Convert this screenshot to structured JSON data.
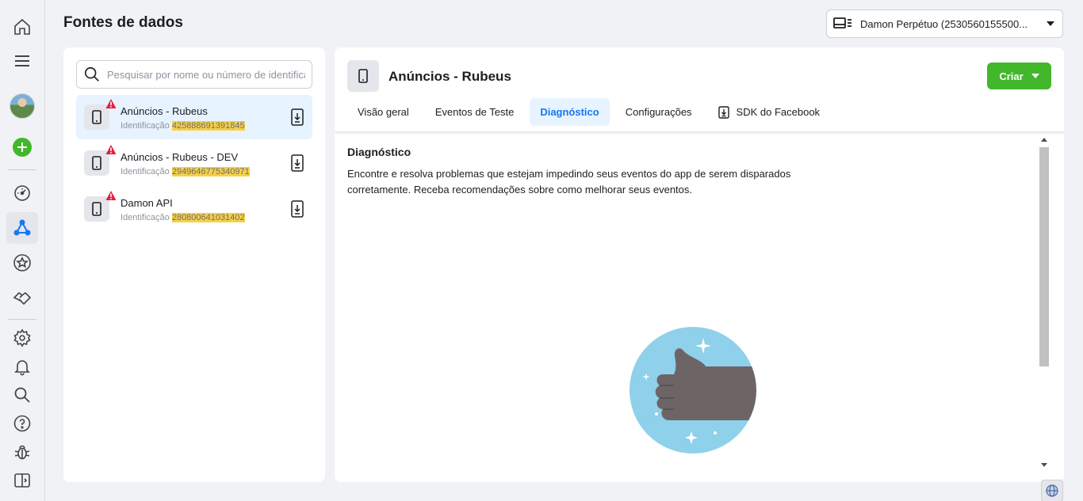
{
  "header": {
    "page_title": "Fontes de dados",
    "account_label": "Damon Perpétuo (2530560155500..."
  },
  "search": {
    "placeholder": "Pesquisar por nome ou número de identificação"
  },
  "sources": [
    {
      "name": "Anúncios - Rubeus",
      "id_label": "Identificação",
      "id_value": "425888691391845",
      "selected": true
    },
    {
      "name": "Anúncios - Rubeus - DEV",
      "id_label": "Identificação",
      "id_value": "2949646775340971",
      "selected": false
    },
    {
      "name": "Damon API",
      "id_label": "Identificação",
      "id_value": "280800641031402",
      "selected": false
    }
  ],
  "detail": {
    "title": "Anúncios - Rubeus",
    "create_label": "Criar",
    "tabs": [
      {
        "label": "Visão geral"
      },
      {
        "label": "Eventos de Teste"
      },
      {
        "label": "Diagnóstico",
        "active": true
      },
      {
        "label": "Configurações"
      },
      {
        "label": "SDK do Facebook",
        "icon": "download-icon"
      }
    ],
    "diagnostics": {
      "title": "Diagnóstico",
      "description": "Encontre e resolva problemas que estejam impedindo seus eventos do app de serem disparados corretamente. Receba recomendações sobre como melhorar seus eventos."
    }
  },
  "colors": {
    "accent": "#1877f2",
    "create_button": "#42b72a",
    "id_highlight": "#f7d046",
    "warning": "#e41e3f",
    "illustration_bg": "#8fd0ea"
  },
  "icons": {
    "rail": [
      "home-icon",
      "menu-icon",
      "avatar",
      "plus-circle-icon",
      "dashboard-gauge-icon",
      "data-sources-icon",
      "star-icon",
      "handshake-icon",
      "gear-icon",
      "bell-icon",
      "search-icon",
      "help-icon",
      "bug-icon",
      "sidebar-toggle-icon"
    ]
  }
}
